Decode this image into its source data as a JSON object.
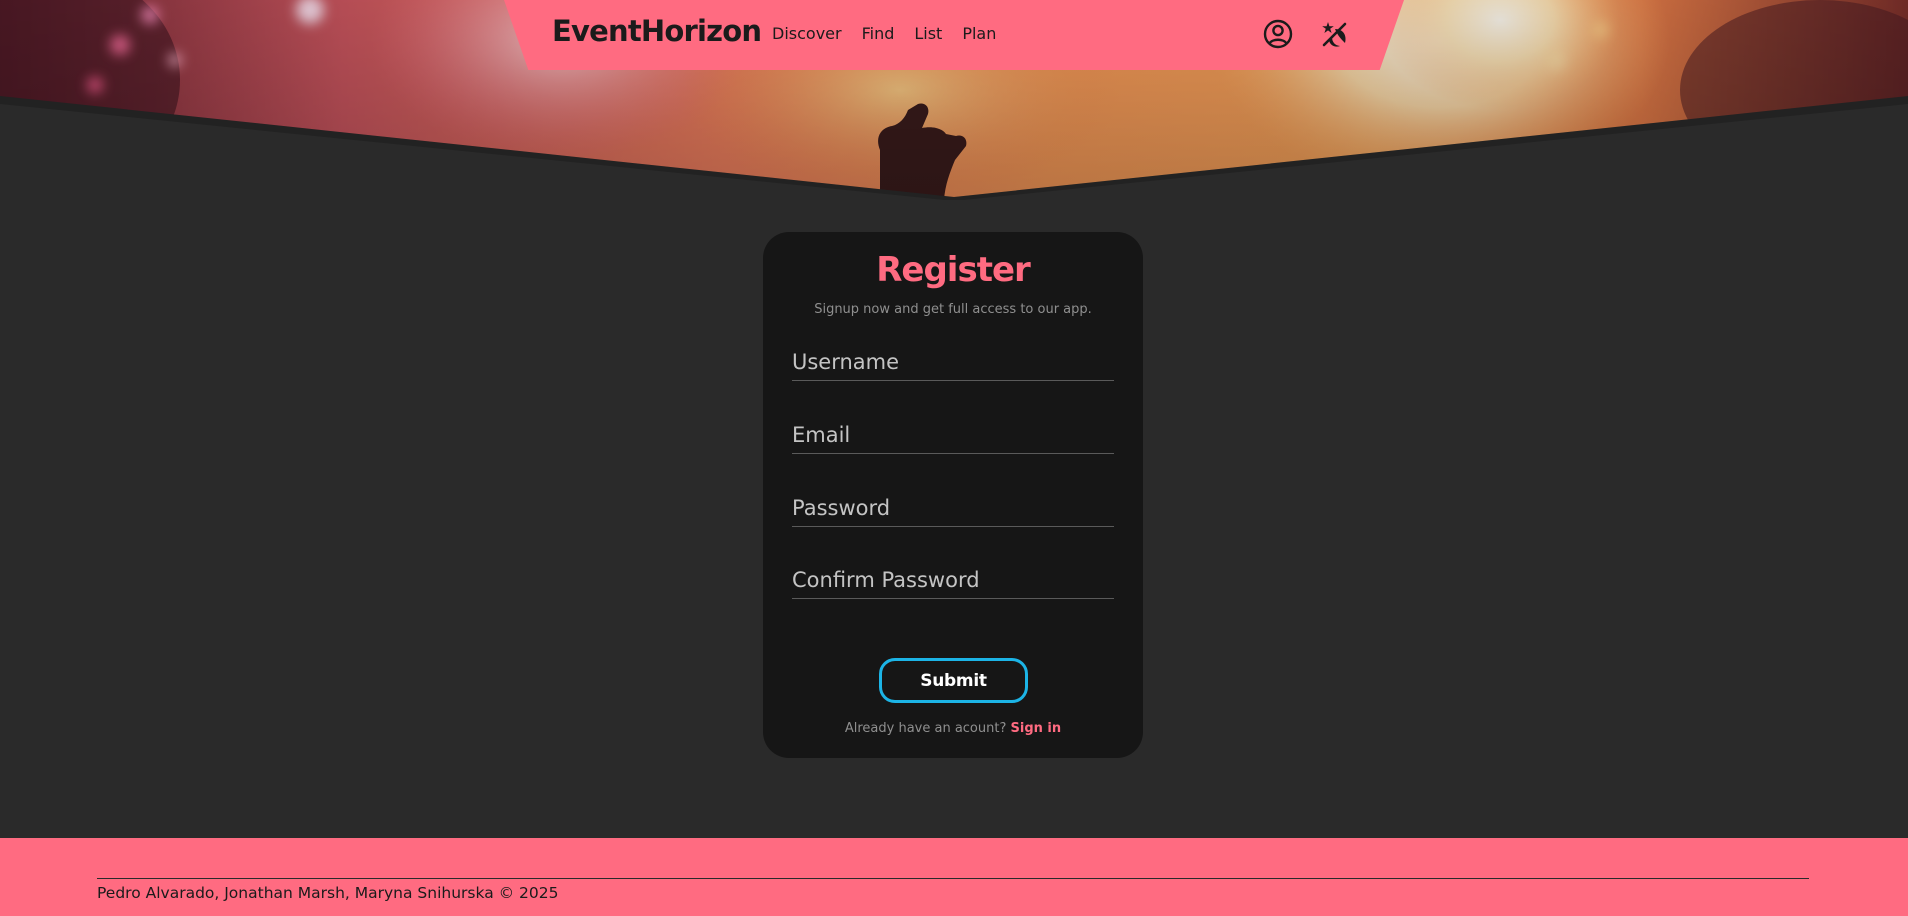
{
  "app": {
    "brand": "EventHorizon"
  },
  "nav": {
    "links": [
      {
        "label": "Discover"
      },
      {
        "label": "Find"
      },
      {
        "label": "List"
      },
      {
        "label": "Plan"
      }
    ],
    "icons": [
      "user-account-icon",
      "theme-toggle-icon"
    ]
  },
  "register": {
    "title": "Register",
    "subtitle": "Signup now and get full access to our app.",
    "fields": {
      "username": {
        "placeholder": "Username",
        "value": ""
      },
      "email": {
        "placeholder": "Email",
        "value": ""
      },
      "password": {
        "placeholder": "Password",
        "value": ""
      },
      "confirm_password": {
        "placeholder": "Confirm Password",
        "value": ""
      }
    },
    "submit_label": "Submit",
    "signin_prompt": "Already have an acount?",
    "signin_link": "Sign in"
  },
  "footer": {
    "credits": "Pedro Alvarado, Jonathan Marsh, Maryna Snihurska © 2025"
  },
  "colors": {
    "accent": "#ff6b81",
    "button_border": "#1cb4e6",
    "page_background": "#2a2a2a",
    "card_background": "#161616",
    "text_dark": "#1b1b1b",
    "text_muted": "#8f8f8f"
  }
}
